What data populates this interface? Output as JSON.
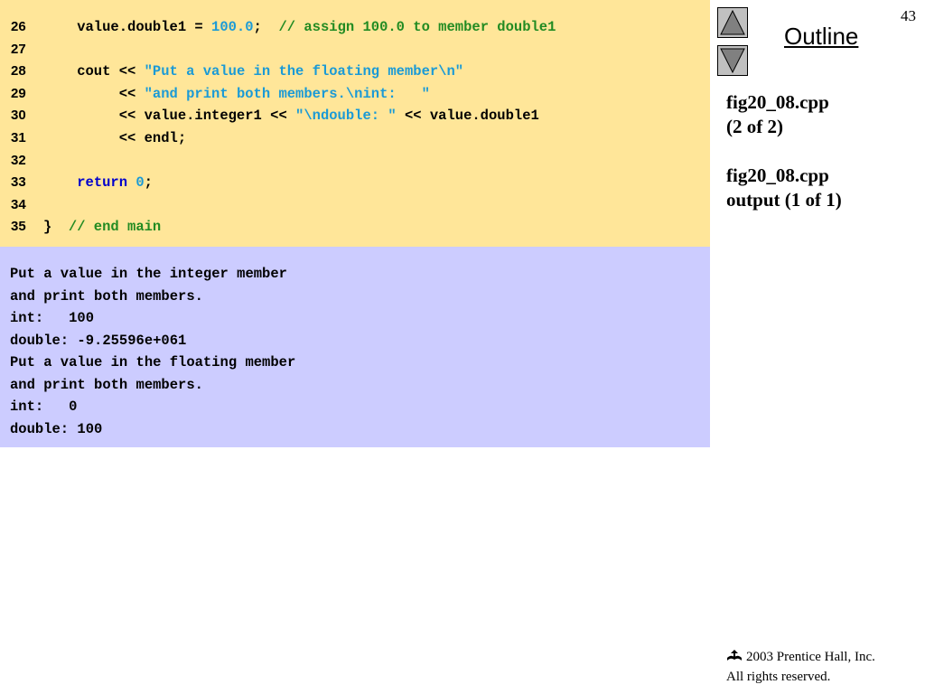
{
  "slide": {
    "number": "43",
    "outline_label": "Outline",
    "notes": [
      {
        "line1": "fig20_08.cpp",
        "line2": "(2 of 2)"
      },
      {
        "line1": "fig20_08.cpp",
        "line2": "output (1 of 1)"
      }
    ],
    "footer": {
      "copyright": "2003 Prentice Hall, Inc.",
      "rights": "All rights reserved."
    }
  },
  "colors": {
    "code_background": "#ffe699",
    "output_background": "#ccccff",
    "keyword": "#0000cc",
    "string": "#1a9ad6",
    "comment": "#228b22"
  },
  "code_lines": [
    {
      "num": "26",
      "segments": [
        {
          "t": "    value.double1 = ",
          "k": "plain"
        },
        {
          "t": "100.0",
          "k": "number"
        },
        {
          "t": ";  ",
          "k": "plain"
        },
        {
          "t": "// assign 100.0 to member double1",
          "k": "comment"
        }
      ]
    },
    {
      "num": "27",
      "segments": []
    },
    {
      "num": "28",
      "segments": [
        {
          "t": "    cout << ",
          "k": "plain"
        },
        {
          "t": "\"Put a value in the floating member\\n\"",
          "k": "string"
        }
      ]
    },
    {
      "num": "29",
      "segments": [
        {
          "t": "         << ",
          "k": "plain"
        },
        {
          "t": "\"and print both members.\\nint:   \"",
          "k": "string"
        }
      ]
    },
    {
      "num": "30",
      "segments": [
        {
          "t": "         << value.integer1 << ",
          "k": "plain"
        },
        {
          "t": "\"\\ndouble: \"",
          "k": "string"
        },
        {
          "t": " << value.double1",
          "k": "plain"
        }
      ]
    },
    {
      "num": "31",
      "segments": [
        {
          "t": "         << endl;",
          "k": "plain"
        }
      ]
    },
    {
      "num": "32",
      "segments": []
    },
    {
      "num": "33",
      "segments": [
        {
          "t": "    ",
          "k": "plain"
        },
        {
          "t": "return",
          "k": "keyword"
        },
        {
          "t": " ",
          "k": "plain"
        },
        {
          "t": "0",
          "k": "number"
        },
        {
          "t": ";",
          "k": "plain"
        }
      ]
    },
    {
      "num": "34",
      "segments": []
    },
    {
      "num": "35",
      "segments": [
        {
          "t": "}  ",
          "k": "plain"
        },
        {
          "t": "// end main",
          "k": "comment"
        }
      ]
    }
  ],
  "output_lines": [
    "Put a value in the integer member",
    "and print both members.",
    "int:   100",
    "double: -9.25596e+061",
    "Put a value in the floating member",
    "and print both members.",
    "int:   0",
    "double: 100"
  ],
  "icons": {
    "prev": "triangle-up-icon",
    "next": "triangle-down-icon",
    "footer_logo": "prentice-hall-logo-icon"
  }
}
